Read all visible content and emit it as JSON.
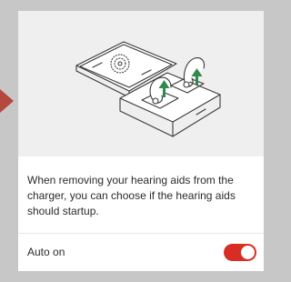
{
  "dialog": {
    "description": "When removing your hearing aids from the charger, you can choose if the hearing aids should startup."
  },
  "setting": {
    "label": "Auto on",
    "enabled": true
  },
  "illustration": {
    "icon": "charger-case-illustration"
  },
  "colors": {
    "accent": "#d82d22",
    "arrow": "#b5473e",
    "background": "#c8c7c7",
    "card": "#ffffff",
    "illustration_bg": "#efefef",
    "indicator_arrows": "#2f8a4e"
  }
}
